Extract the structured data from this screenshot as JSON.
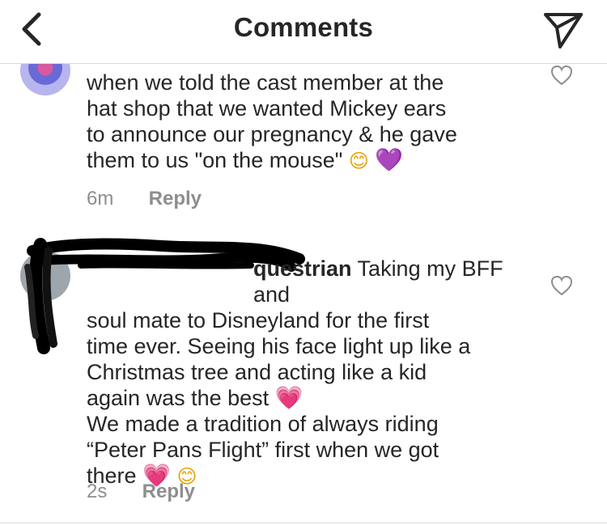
{
  "header": {
    "title": "Comments",
    "back_icon": "chevron-left-icon",
    "send_icon": "paper-plane-icon"
  },
  "comments": [
    {
      "username_hidden": "",
      "text_lines": [
        "when we told the cast member at the",
        "hat shop that we wanted Mickey ears",
        "to announce our pregnancy & he gave",
        "them to us \"on the mouse\""
      ],
      "emojis": [
        "😊",
        "💜"
      ],
      "time": "6m",
      "reply_label": "Reply",
      "like_icon": "heart-outline-icon"
    },
    {
      "username_visible": "questrian",
      "text_lines": [
        "Taking my BFF and",
        "soul mate to Disneyland for the first",
        "time ever. Seeing his face light up like a",
        "Christmas tree and acting like a kid",
        "again was the best"
      ],
      "emoji_line_1": "💗",
      "second_paragraph": [
        "We made a tradition of always riding",
        "“Peter Pans Flight” first when we got",
        "there"
      ],
      "emojis_end": [
        "💗",
        "😊"
      ],
      "time": "2s",
      "reply_label": "Reply",
      "like_icon": "heart-outline-icon"
    }
  ],
  "colors": {
    "text": "#262626",
    "muted": "#8e8e8e",
    "divider": "#dbdbdb"
  }
}
